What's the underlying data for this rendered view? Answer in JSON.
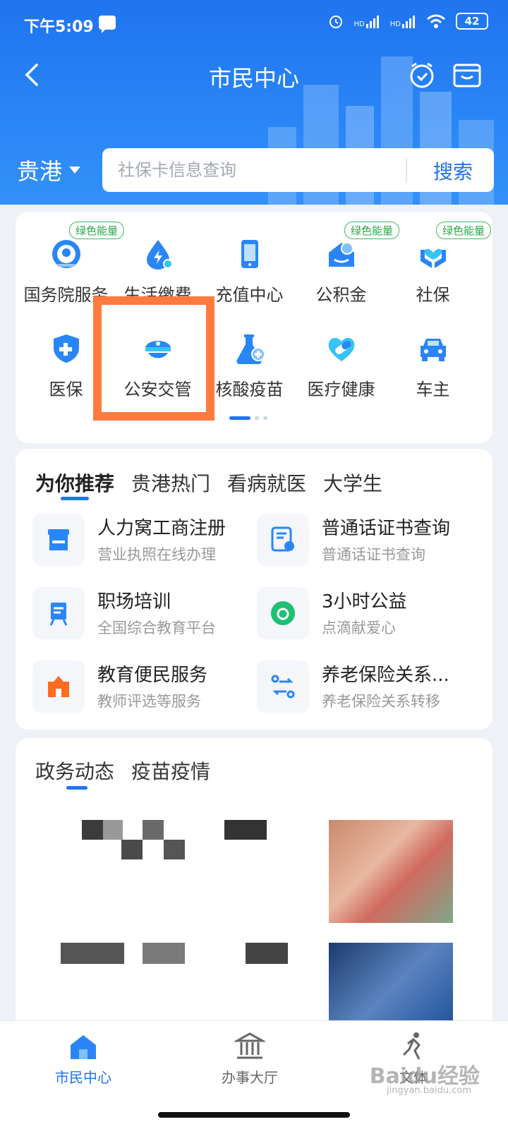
{
  "status_bar": {
    "time": "下午5:09",
    "battery": "42",
    "signal_labels": [
      "HD",
      "HD"
    ]
  },
  "header": {
    "title": "市民中心",
    "location": "贵港",
    "search_placeholder": "社保卡信息查询",
    "search_button": "搜索"
  },
  "services": [
    {
      "label": "国务院服务",
      "badge": "绿色能量",
      "icon": "gov-emblem-icon"
    },
    {
      "label": "生活缴费",
      "badge": "",
      "icon": "bolt-drop-icon"
    },
    {
      "label": "充值中心",
      "badge": "",
      "icon": "phone-icon"
    },
    {
      "label": "公积金",
      "badge": "绿色能量",
      "icon": "house-yuan-icon"
    },
    {
      "label": "社保",
      "badge": "绿色能量",
      "icon": "hands-heart-icon"
    },
    {
      "label": "医保",
      "badge": "",
      "icon": "medical-shield-icon"
    },
    {
      "label": "公安交管",
      "badge": "",
      "icon": "police-cap-icon"
    },
    {
      "label": "核酸疫苗",
      "badge": "",
      "icon": "flask-icon"
    },
    {
      "label": "医疗健康",
      "badge": "",
      "icon": "heart-pill-icon"
    },
    {
      "label": "车主",
      "badge": "",
      "icon": "car-icon"
    }
  ],
  "recommend": {
    "tabs": [
      "为你推荐",
      "贵港热门",
      "看病就医",
      "大学生"
    ],
    "items": [
      {
        "title": "人力窝工商注册",
        "subtitle": "营业执照在线办理",
        "icon": "shop-icon"
      },
      {
        "title": "普通话证书查询",
        "subtitle": "普通话证书查询",
        "icon": "certificate-icon"
      },
      {
        "title": "职场培训",
        "subtitle": "全国综合教育平台",
        "icon": "easel-icon"
      },
      {
        "title": "3小时公益",
        "subtitle": "点滴献爱心",
        "icon": "charity-icon"
      },
      {
        "title": "教育便民服务",
        "subtitle": "教师评选等服务",
        "icon": "school-icon"
      },
      {
        "title": "养老保险关系...",
        "subtitle": "养老保险关系转移",
        "icon": "transfer-icon"
      }
    ]
  },
  "news": {
    "tabs": [
      "政务动态",
      "疫苗疫情"
    ]
  },
  "bottom_nav": [
    {
      "label": "市民中心",
      "icon": "home-icon"
    },
    {
      "label": "办事大厅",
      "icon": "bank-hall-icon"
    },
    {
      "label": "文体",
      "icon": "runner-icon"
    }
  ],
  "watermark": {
    "logo": "Baidu经验",
    "url": "jingyan.baidu.com"
  },
  "colors": {
    "primary": "#1f74ef",
    "highlight": "#ff7a3d",
    "badge_green": "#2ea54d"
  }
}
